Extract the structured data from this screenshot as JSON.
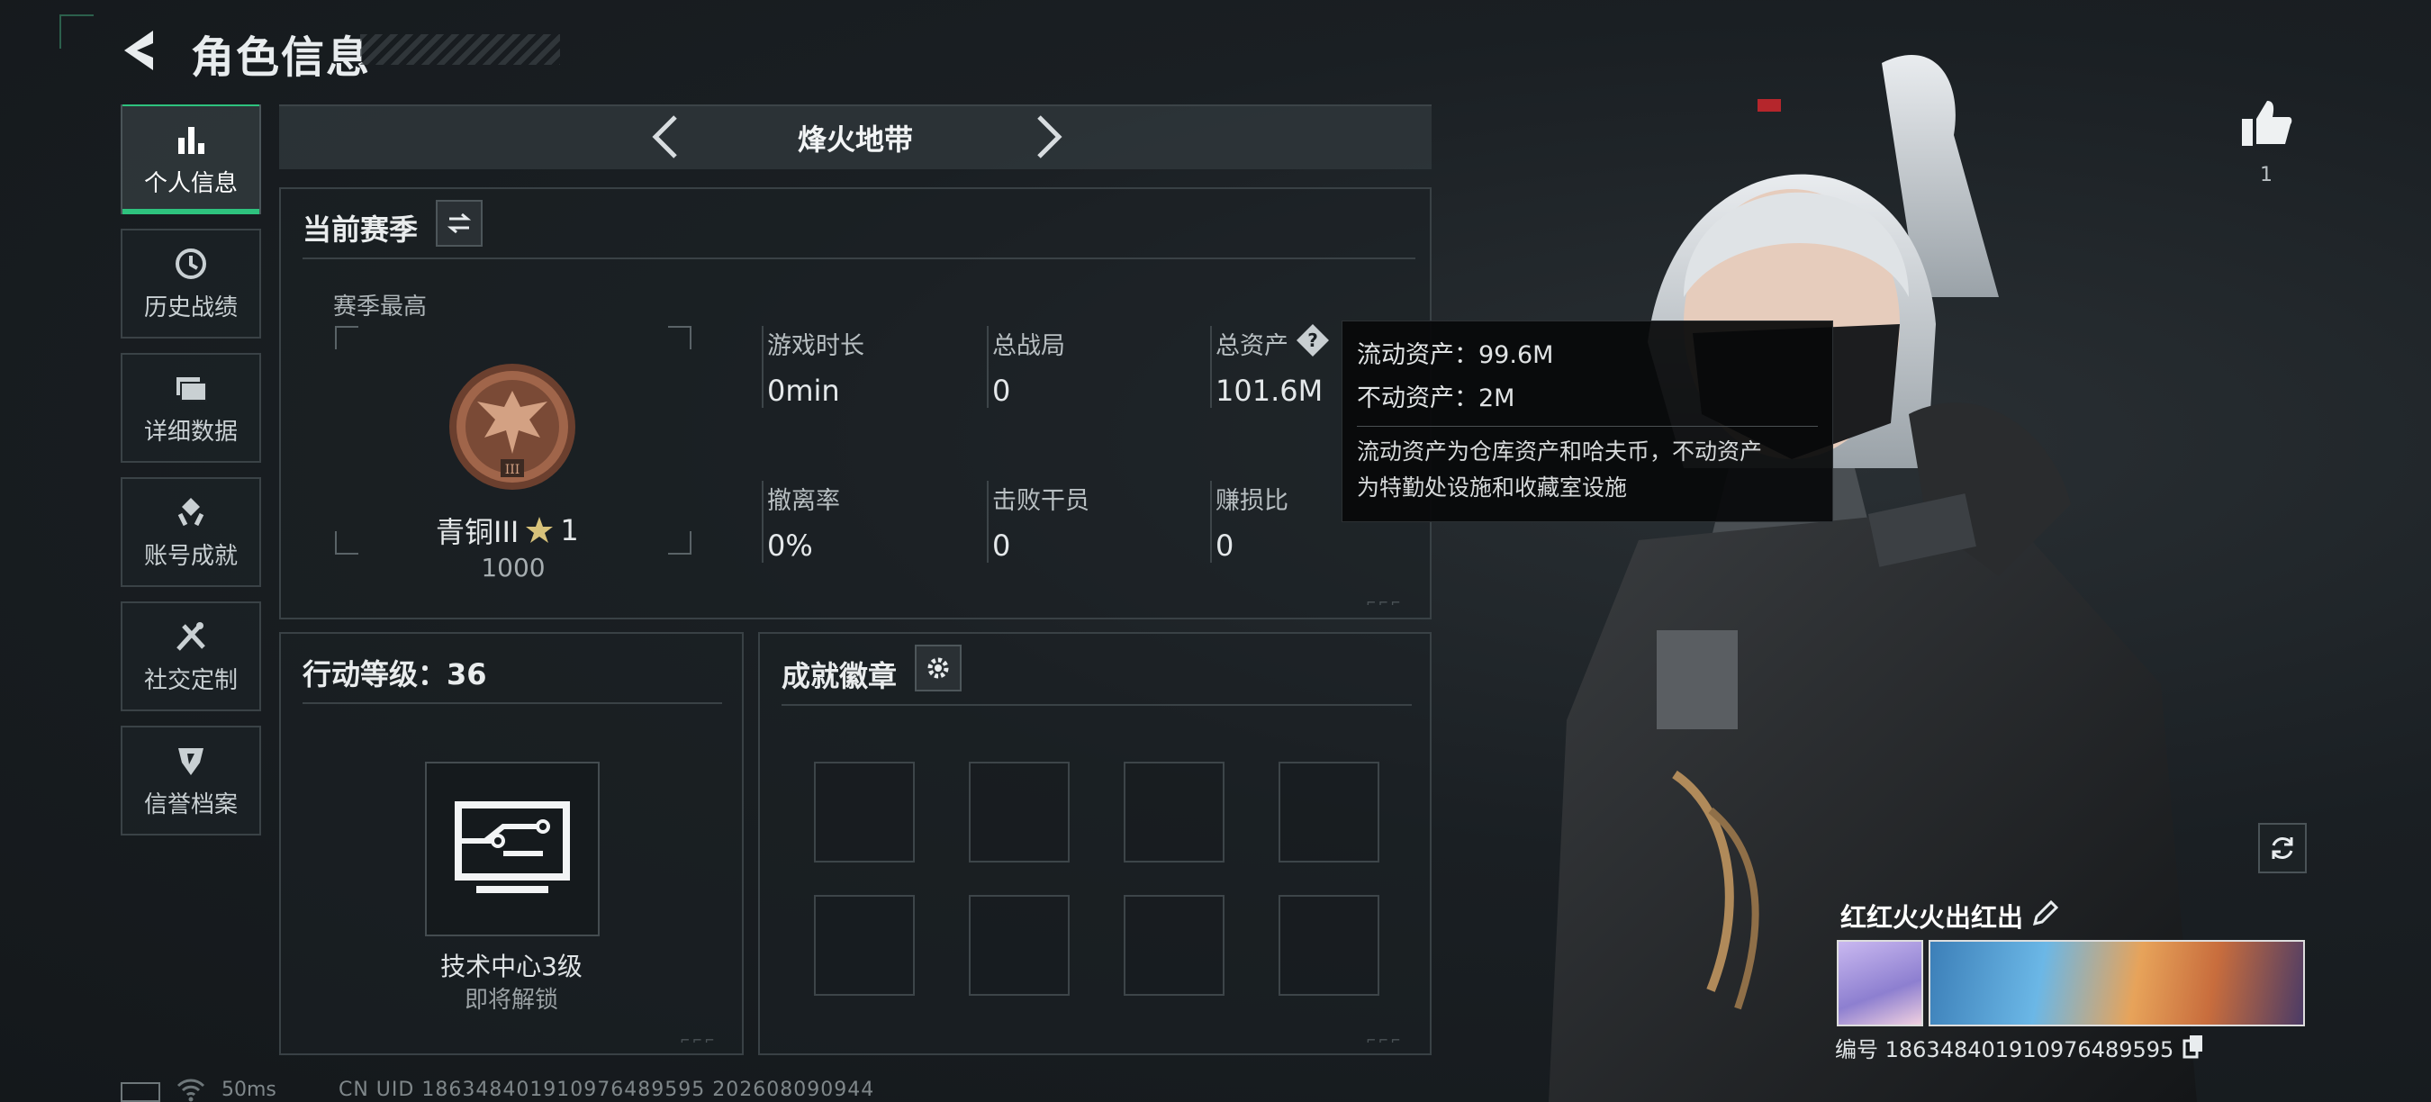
{
  "header": {
    "title": "角色信息"
  },
  "sidebar": {
    "items": [
      {
        "label": "个人信息",
        "icon": "bar-chart-icon",
        "active": true
      },
      {
        "label": "历史战绩",
        "icon": "history-clock-icon"
      },
      {
        "label": "详细数据",
        "icon": "folder-icon"
      },
      {
        "label": "账号成就",
        "icon": "achievement-icon"
      },
      {
        "label": "社交定制",
        "icon": "tools-icon"
      },
      {
        "label": "信誉档案",
        "icon": "credit-shield-icon"
      }
    ]
  },
  "mode": {
    "name": "烽火地带"
  },
  "season": {
    "title": "当前赛季",
    "best_label": "赛季最高",
    "rank_name": "青铜III",
    "rank_stars": "1",
    "rank_score": "1000",
    "stats": [
      {
        "label": "游戏时长",
        "value": "0min"
      },
      {
        "label": "总战局",
        "value": "0"
      },
      {
        "label": "总资产",
        "value": "101.6M"
      },
      {
        "label": "撤离率",
        "value": "0%"
      },
      {
        "label": "击败干员",
        "value": "0"
      },
      {
        "label": "赚损比",
        "value": "0"
      }
    ]
  },
  "tooltip": {
    "liquid": "流动资产：99.6M",
    "fixed": "不动资产：2M",
    "desc1": "流动资产为仓库资产和哈夫币，不动资产",
    "desc2": "为特勤处设施和收藏室设施"
  },
  "level": {
    "title": "行动等级：36",
    "tech_name": "技术中心3级",
    "tech_sub": "即将解锁"
  },
  "badges": {
    "title": "成就徽章",
    "slots": 8
  },
  "like": {
    "count": "1"
  },
  "player": {
    "name": "红红火火出红出",
    "id": "编号 1863484019109764895​95"
  },
  "status": {
    "ping": "50ms",
    "uid": "CN UID 1863484019109764895​95 202608090944"
  },
  "colors": {
    "accent": "#2ec27e",
    "panel_border": "#394145",
    "bronze": "#a0654a"
  }
}
